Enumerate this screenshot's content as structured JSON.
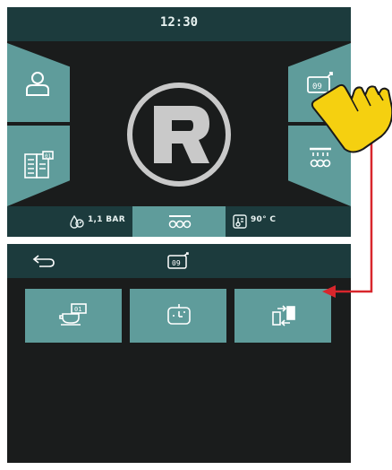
{
  "top_screen": {
    "clock": "12:30",
    "status": {
      "pressure": "1,1 BAR",
      "temperature": "90° C"
    },
    "tiles": {
      "left_top_icon": "user-icon",
      "left_bottom_icon": "menu-book-icon",
      "right_top_icon": "counter-display-icon",
      "right_bottom_icon": "rinse-shower-icon",
      "bottom_center_icon": "group-heads-icon",
      "logo": "R"
    }
  },
  "bottom_screen": {
    "header": {
      "back_icon": "back-arrow-icon",
      "center_icon": "counter-display-icon"
    },
    "buttons": [
      {
        "icon": "cup-counter-icon"
      },
      {
        "icon": "timer-display-icon"
      },
      {
        "icon": "swap-cycle-icon"
      }
    ]
  },
  "colors": {
    "tile": "#5f9c9b",
    "bar": "#1c3b3d",
    "screen": "#1a1c1c",
    "connector": "#d8262c",
    "hand": "#f5d010"
  }
}
